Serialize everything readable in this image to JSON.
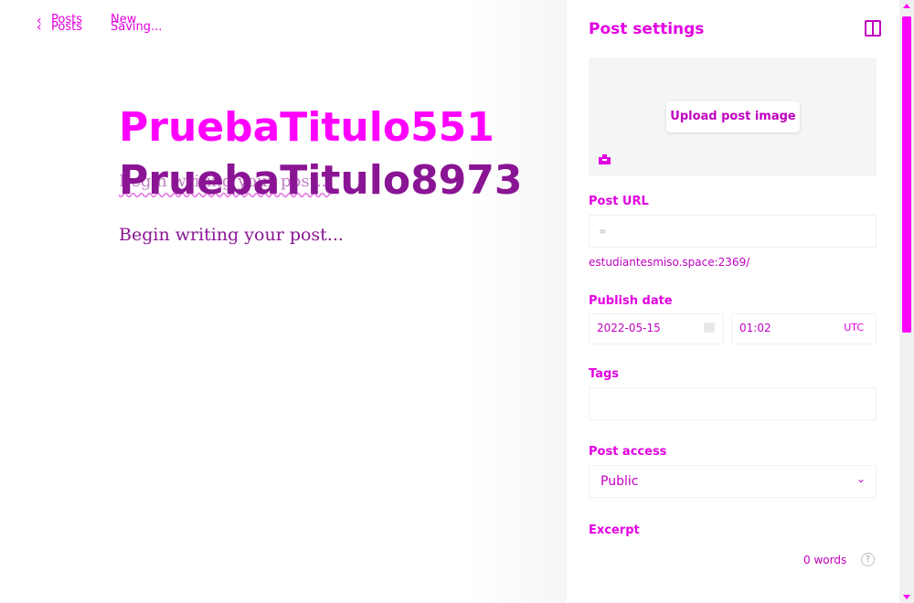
{
  "header": {
    "back_label_1": "Posts",
    "back_label_2": "Posts",
    "status_1": "New",
    "status_2": "Saving..."
  },
  "editor": {
    "title_primary": "PruebaTitulo551",
    "title_secondary": "PruebaTitulo8973",
    "ghost_placeholder": "Begin writing your post...",
    "body_placeholder": "Begin writing your post..."
  },
  "settings": {
    "title": "Post settings",
    "upload_label": "Upload post image",
    "post_url_label": "Post URL",
    "post_url_value": "",
    "url_hint": "estudiantesmiso.space:2369/",
    "publish_date_label": "Publish date",
    "date_value": "2022-05-15",
    "time_value": "01:02",
    "timezone": "UTC",
    "tags_label": "Tags",
    "post_access_label": "Post access",
    "post_access_value": "Public",
    "excerpt_label": "Excerpt",
    "word_count": "0 words"
  },
  "icons": {
    "back": "chevron-left-icon",
    "close": "sidebar-close-icon",
    "image": "image-icon",
    "link": "link-icon",
    "calendar": "calendar-icon",
    "dropdown": "chevron-down-icon",
    "help": "question-circle-icon"
  },
  "colors": {
    "accent": "#e200e2",
    "title_primary": "#ff00ff",
    "title_secondary": "#8a1594",
    "scrollbar": "#ff00ff"
  }
}
